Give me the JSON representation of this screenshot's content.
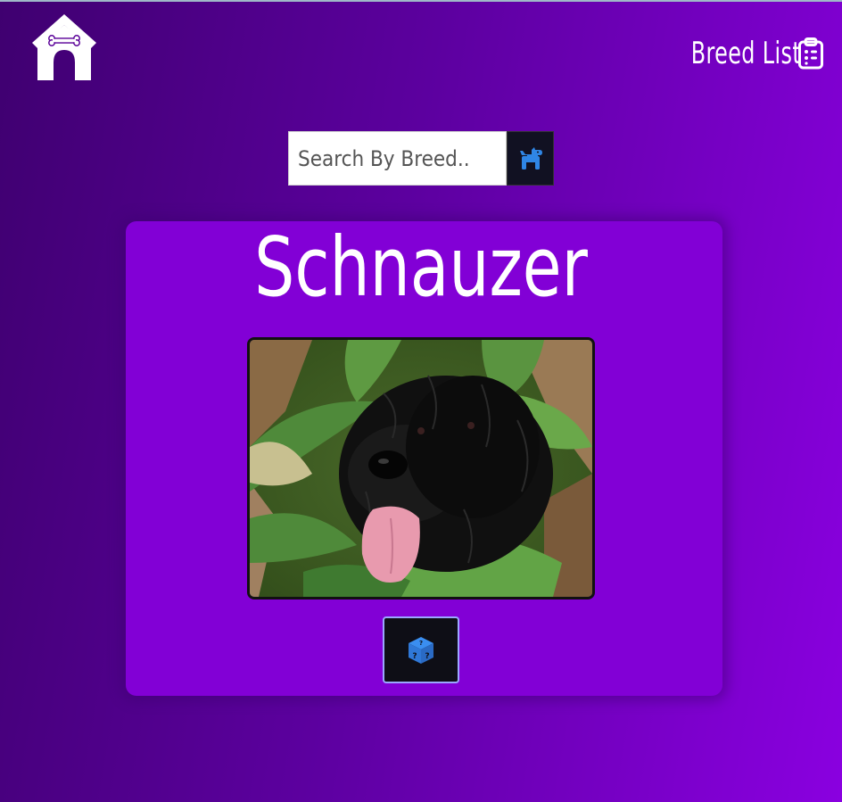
{
  "header": {
    "home_icon": "dog-house-icon",
    "nav": {
      "breed_list_label": "Breed List",
      "breed_list_icon": "clipboard-list-icon"
    }
  },
  "search": {
    "placeholder": "Search By Breed..",
    "value": "",
    "button_icon": "dog-icon"
  },
  "breed_card": {
    "title": "Schnauzer",
    "image_alt": "black schnauzer dog among green leaves",
    "random_button_icon": "dice-icon"
  },
  "colors": {
    "background_start": "#3f0070",
    "background_end": "#8a00e0",
    "card": "#8200d6",
    "icon_accent": "#2f86e6",
    "button_dark": "#111122"
  }
}
